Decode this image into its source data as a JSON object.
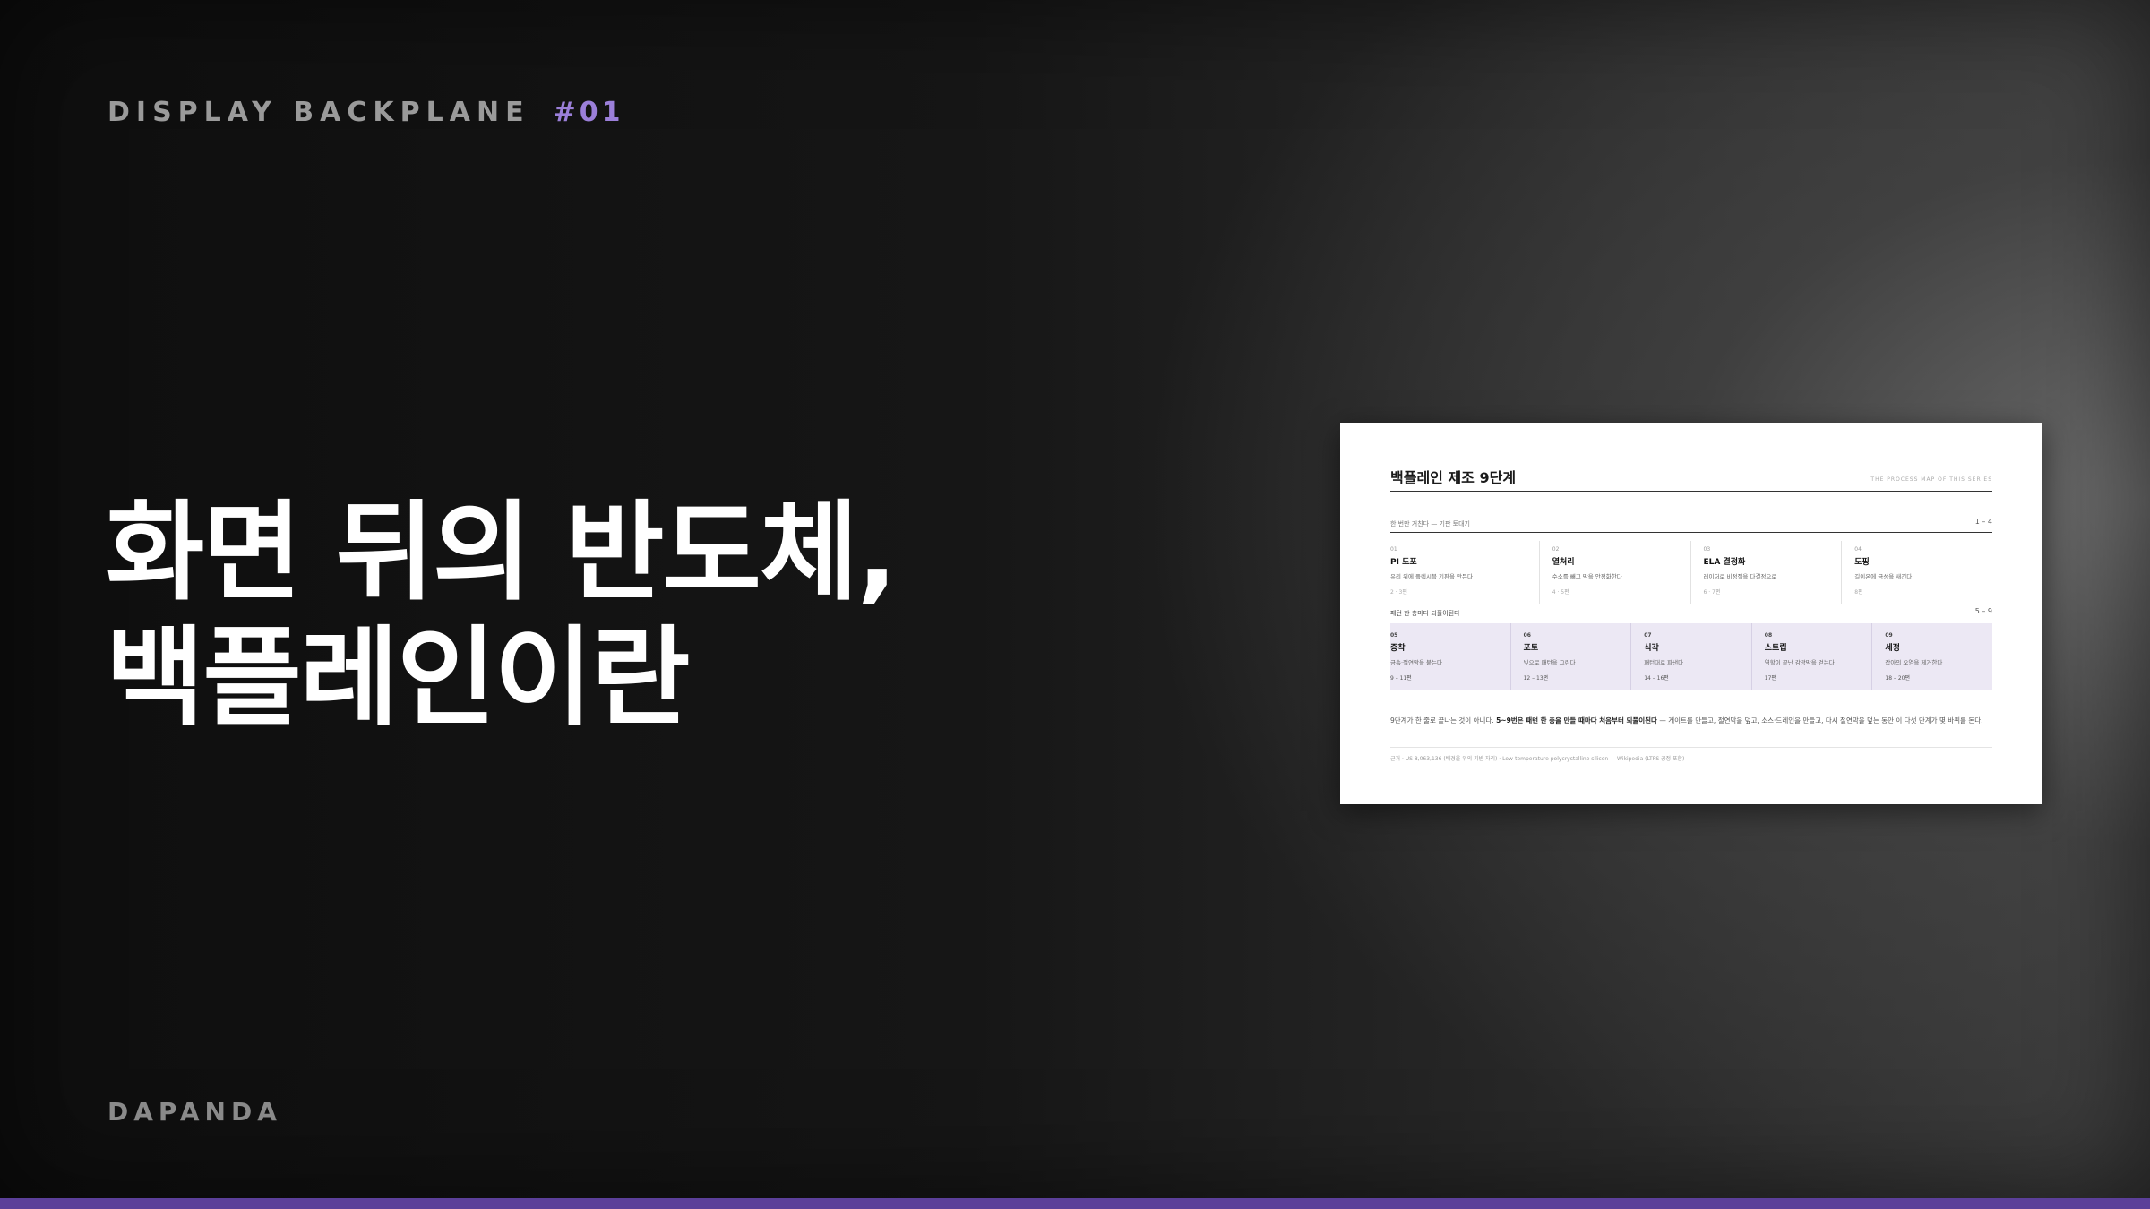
{
  "kicker": {
    "label": "DISPLAY BACKPLANE",
    "number": "#01"
  },
  "headline": {
    "line1": "화면 뒤의 반도체,",
    "line2": "백플레인이란"
  },
  "brand": "DAPANDA",
  "card": {
    "title": "백플레인 제조 9단계",
    "title_right": "THE PROCESS MAP OF THIS SERIES",
    "section1": {
      "label": "한 번만 거친다 — 기판 토대기",
      "range": "1 – 4",
      "steps": [
        {
          "num": "01",
          "name": "PI 도포",
          "desc": "유리 위에 플렉시블 기판을 만든다",
          "week": "2 · 3편"
        },
        {
          "num": "02",
          "name": "열처리",
          "desc": "수소를 빼고 막을 안정화한다",
          "week": "4 · 5편"
        },
        {
          "num": "03",
          "name": "ELA 결정화",
          "desc": "레이저로 비정질을 다결정으로",
          "week": "6 · 7편"
        },
        {
          "num": "04",
          "name": "도핑",
          "desc": "길이온에 극성을 새긴다",
          "week": "8편"
        }
      ]
    },
    "section2": {
      "label": "패턴 한 층마다 되풀이된다",
      "range": "5 – 9",
      "steps": [
        {
          "num": "05",
          "name": "증착",
          "desc": "금속·절연막을 붙는다",
          "week": "9 – 11편"
        },
        {
          "num": "06",
          "name": "포토",
          "desc": "빛으로 패턴을 그린다",
          "week": "12 – 13편"
        },
        {
          "num": "07",
          "name": "식각",
          "desc": "패턴대로 파낸다",
          "week": "14 – 16편"
        },
        {
          "num": "08",
          "name": "스트립",
          "desc": "역할이 끝난 감광막을 걷는다",
          "week": "17편"
        },
        {
          "num": "09",
          "name": "세정",
          "desc": "잡아의 오염을 제거한다",
          "week": "18 – 20편"
        }
      ]
    },
    "summary_pre": "9단계가 한 줄로 끝나는 것이 아니다. ",
    "summary_bold": "5~9번은 패턴 한 층을 만들 때마다 처음부터 되풀이된다",
    "summary_post": " — 게이트를 만들고, 절연막을 덮고, 소스·드레인을 만들고, 다시 절연막을 덮는 동안 이 다섯 단계가 몇 바퀴를 돈다.",
    "source": "근거 · US 8,063,136 (배경을 위의 기반 자리) · Low-temperature polycrystalline silicon — Wikipedia (LTPS 공정 포함)"
  },
  "colors": {
    "accent": "#9b7fd9",
    "bar": "#5b3f99",
    "highlight_row": "#ece8f4"
  }
}
